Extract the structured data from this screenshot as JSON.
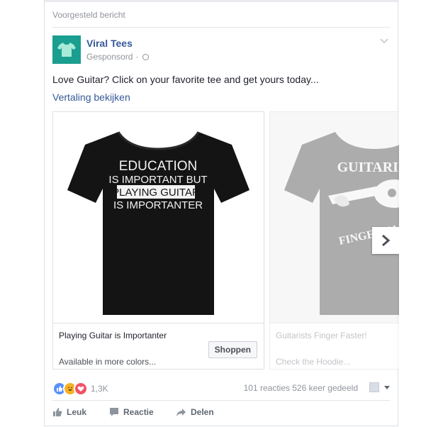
{
  "header": {
    "suggested_label": "Voorgesteld bericht"
  },
  "post": {
    "page_name": "Viral Tees",
    "sponsored_label": "Gesponsord",
    "dot": "·",
    "text": "Love Guitar? Click on your favorite tee and get yours today...",
    "see_translation": "Vertaling bekijken"
  },
  "carousel": {
    "cards": [
      {
        "shirt_lines": [
          "EDUCATION",
          "IS IMPORTANT BUT",
          "PLAYING GUITAR",
          "IS IMPORTANTER"
        ],
        "title": "Playing Guitar is Importanter",
        "subtitle": "Available in more colors...",
        "cta": "Shoppen",
        "shirt_color": "#141414"
      },
      {
        "shirt_lines": [
          "GUITARIST",
          "FINGER FAST"
        ],
        "title": "Guitarists Finger Faster!",
        "subtitle": "Check the Hoodie...",
        "shirt_color": "#6a6a6a"
      }
    ],
    "next_icon": "chevron-right-icon"
  },
  "stats": {
    "reaction_icons": [
      "like-icon",
      "haha-icon",
      "love-icon"
    ],
    "reaction_count": "1,3K",
    "comments": "101 reacties",
    "shares": "526 keer gedeeld"
  },
  "actions": {
    "like": "Leuk",
    "comment": "Reactie",
    "share": "Delen"
  },
  "colors": {
    "link": "#365899",
    "logo_bg": "#1a9e8f",
    "like_blue": "#5890ff",
    "love_red": "#f25268",
    "haha_yellow": "#f7b125"
  }
}
